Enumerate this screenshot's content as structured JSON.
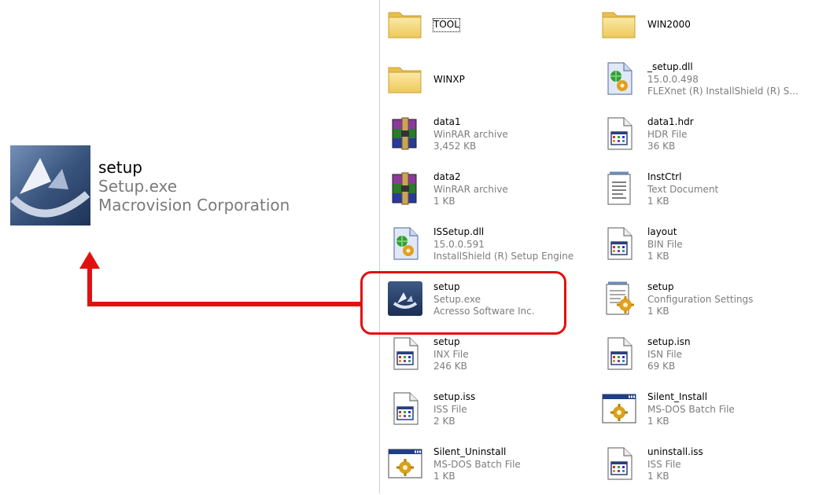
{
  "callout": {
    "name": "setup",
    "filename": "Setup.exe",
    "company": "Macrovision Corporation"
  },
  "files": [
    {
      "name": "TOOL",
      "line2": "",
      "line3": "",
      "icon": "folder-icon"
    },
    {
      "name": "WIN2000",
      "line2": "",
      "line3": "",
      "icon": "folder-icon"
    },
    {
      "name": "WINXP",
      "line2": "",
      "line3": "",
      "icon": "folder-icon"
    },
    {
      "name": "_setup.dll",
      "line2": "15.0.0.498",
      "line3": "FLEXnet (R) InstallShield (R) S...",
      "icon": "dll-icon"
    },
    {
      "name": "data1",
      "line2": "WinRAR archive",
      "line3": "3,452 KB",
      "icon": "winrar-icon"
    },
    {
      "name": "data1.hdr",
      "line2": "HDR File",
      "line3": "36 KB",
      "icon": "generic-file-icon"
    },
    {
      "name": "data2",
      "line2": "WinRAR archive",
      "line3": "1 KB",
      "icon": "winrar-icon"
    },
    {
      "name": "InstCtrl",
      "line2": "Text Document",
      "line3": "1 KB",
      "icon": "text-document-icon"
    },
    {
      "name": "ISSetup.dll",
      "line2": "15.0.0.591",
      "line3": "InstallShield (R) Setup Engine",
      "icon": "dll-icon"
    },
    {
      "name": "layout",
      "line2": "BIN File",
      "line3": "1 KB",
      "icon": "generic-file-icon"
    },
    {
      "name": "setup",
      "line2": "Setup.exe",
      "line3": "Acresso Software Inc.",
      "icon": "setup-exe-icon"
    },
    {
      "name": "setup",
      "line2": "Configuration Settings",
      "line3": "1 KB",
      "icon": "config-settings-icon"
    },
    {
      "name": "setup",
      "line2": "INX File",
      "line3": "246 KB",
      "icon": "generic-file-icon"
    },
    {
      "name": "setup.isn",
      "line2": "ISN File",
      "line3": "69 KB",
      "icon": "generic-file-icon"
    },
    {
      "name": "setup.iss",
      "line2": "ISS File",
      "line3": "2 KB",
      "icon": "generic-file-icon"
    },
    {
      "name": "Silent_Install",
      "line2": "MS-DOS Batch File",
      "line3": "1 KB",
      "icon": "batch-file-icon"
    },
    {
      "name": "Silent_Uninstall",
      "line2": "MS-DOS Batch File",
      "line3": "1 KB",
      "icon": "batch-file-icon"
    },
    {
      "name": "uninstall.iss",
      "line2": "ISS File",
      "line3": "1 KB",
      "icon": "generic-file-icon"
    }
  ],
  "colors": {
    "highlight": "#e31010",
    "arrow": "#e31010",
    "folder": "#f5d97a"
  }
}
